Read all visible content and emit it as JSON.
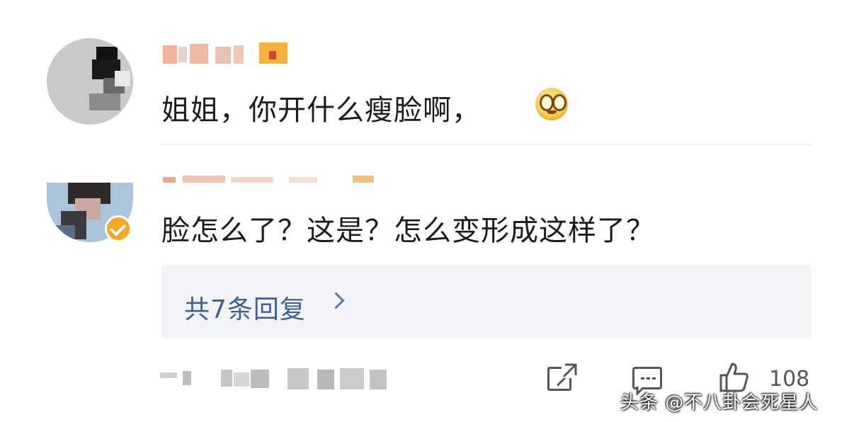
{
  "comments": [
    {
      "text": "姐姐，你开什么瘦脸啊，",
      "emoji": "grin-face-emoji"
    },
    {
      "text": "脸怎么了？这是？怎么变形成这样了？",
      "verified": true,
      "replies_label": "共7条回复"
    }
  ],
  "actions": {
    "like_count": "108",
    "icons": [
      "share-icon",
      "comment-icon",
      "like-icon"
    ]
  },
  "watermark": "头条 @不八卦会死星人",
  "colors": {
    "reply_link": "#3f5f96",
    "reply_box_bg": "#f3f4f7",
    "verified_badge": "#f5a623"
  }
}
